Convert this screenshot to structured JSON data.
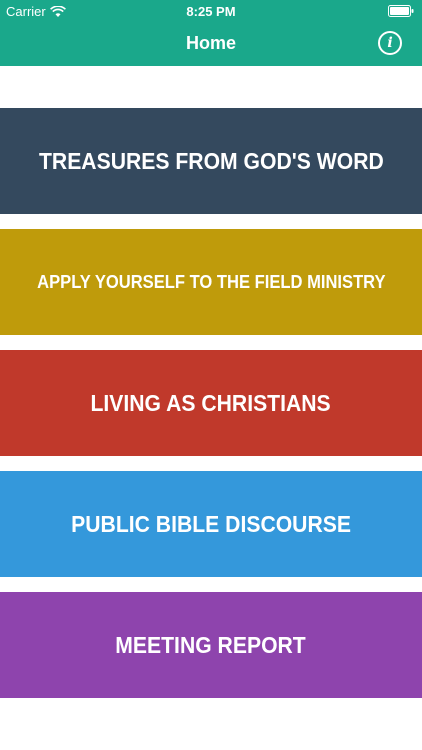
{
  "status_bar": {
    "carrier": "Carrier",
    "time": "8:25 PM"
  },
  "header": {
    "title": "Home",
    "info_icon": "info-icon",
    "background": "#1aa88b"
  },
  "menu": {
    "items": [
      {
        "label": "TREASURES FROM GOD'S WORD",
        "color": "#34495e"
      },
      {
        "label": "APPLY YOURSELF TO THE FIELD MINISTRY",
        "color": "#bf9b0b"
      },
      {
        "label": "LIVING AS CHRISTIANS",
        "color": "#c0392b"
      },
      {
        "label": "PUBLIC BIBLE DISCOURSE",
        "color": "#3498db"
      },
      {
        "label": "MEETING REPORT",
        "color": "#8e44ad"
      }
    ]
  }
}
